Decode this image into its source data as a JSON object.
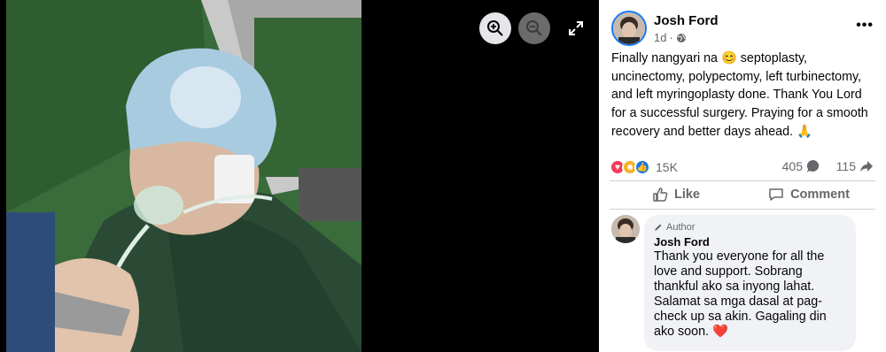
{
  "viewer": {
    "zoom_in_icon": "zoom-in-icon",
    "zoom_out_icon": "zoom-out-icon",
    "expand_icon": "expand-icon",
    "photo_description_icon": "photo"
  },
  "post": {
    "author": "Josh Ford",
    "time": "1d",
    "privacy_icon": "globe-icon",
    "more_icon": "more-icon",
    "text_before_emoji": "Finally nangyari na",
    "emoji_1": "😊",
    "text_after_emoji": " septoplasty, uncinectomy, polypectomy, left turbinectomy, and left myringoplasty done. Thank You Lord for a successful surgery. Praying for a smooth recovery and better days ahead.",
    "emoji_2": "🙏",
    "reactions_count": "15K",
    "comments_count": "405",
    "shares_count": "115",
    "like_label": "Like",
    "comment_label": "Comment"
  },
  "comment": {
    "badge": "Author",
    "name": "Josh Ford",
    "text": "Thank you everyone for all the love and support. Sobrang thankful ako sa inyong lahat. Salamat sa mga dasal at pag-check up sa akin. Gagaling din ako soon.",
    "emoji": "❤️"
  },
  "colors": {
    "accent": "#1877f2",
    "love": "#f33e58",
    "care": "#f7b125",
    "secondary_text": "#65676b"
  }
}
